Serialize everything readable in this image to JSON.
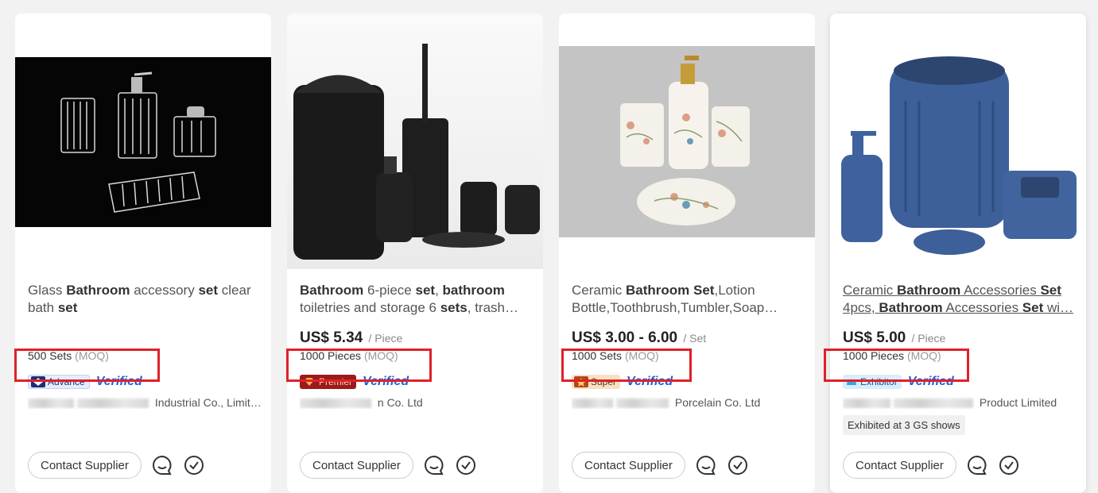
{
  "products": [
    {
      "title_parts": [
        [
          "Glass ",
          false
        ],
        [
          "Bathroom",
          true
        ],
        [
          " accessory ",
          false
        ],
        [
          "set",
          true
        ],
        [
          " clear bath ",
          false
        ],
        [
          "set",
          true
        ]
      ],
      "price": "",
      "price_unit": "",
      "moq_qty": "500 Sets",
      "moq_label": "(MOQ)",
      "badge_label": "Advance",
      "verified": "Verified",
      "supplier": "Industrial Co., Limit…",
      "exhibited": "",
      "contact": "Contact Supplier"
    },
    {
      "title_parts": [
        [
          "Bathroom",
          true
        ],
        [
          " 6-piece ",
          false
        ],
        [
          "set",
          true
        ],
        [
          ", ",
          false
        ],
        [
          "bathroom",
          true
        ],
        [
          " toiletries and storage 6 ",
          false
        ],
        [
          "sets",
          true
        ],
        [
          ", trash…",
          false
        ]
      ],
      "price": "US$ 5.34",
      "price_unit": "/ Piece",
      "moq_qty": "1000 Pieces",
      "moq_label": "(MOQ)",
      "badge_label": "Premier",
      "verified": "Verified",
      "supplier": "n Co. Ltd",
      "exhibited": "",
      "contact": "Contact Supplier"
    },
    {
      "title_parts": [
        [
          "Ceramic ",
          false
        ],
        [
          "Bathroom Set",
          true
        ],
        [
          ",Lotion Bottle,Toothbrush,Tumbler,Soap…",
          false
        ]
      ],
      "price": "US$ 3.00 - 6.00",
      "price_unit": "/ Set",
      "moq_qty": "1000 Sets",
      "moq_label": "(MOQ)",
      "badge_label": "Super",
      "verified": "Verified",
      "supplier": "Porcelain Co. Ltd",
      "exhibited": "",
      "contact": "Contact Supplier"
    },
    {
      "title_parts": [
        [
          "Ceramic ",
          false
        ],
        [
          "Bathroom",
          true
        ],
        [
          " Accessories ",
          false
        ],
        [
          "Set",
          true
        ],
        [
          " 4pcs, ",
          false
        ],
        [
          "Bathroom",
          true
        ],
        [
          " Accessories ",
          false
        ],
        [
          "Set",
          true
        ],
        [
          " wi…",
          false
        ]
      ],
      "price": "US$ 5.00",
      "price_unit": "/ Piece",
      "moq_qty": "1000 Pieces",
      "moq_label": "(MOQ)",
      "badge_label": "Exhibitor",
      "verified": "Verified",
      "supplier": "Product Limited",
      "exhibited": "Exhibited at 3 GS shows",
      "contact": "Contact Supplier"
    }
  ],
  "colors": {
    "highlight_box": "#e0202a",
    "verified": "#1d62d8"
  },
  "icons": [
    "chat-icon",
    "checkmark-icon"
  ]
}
